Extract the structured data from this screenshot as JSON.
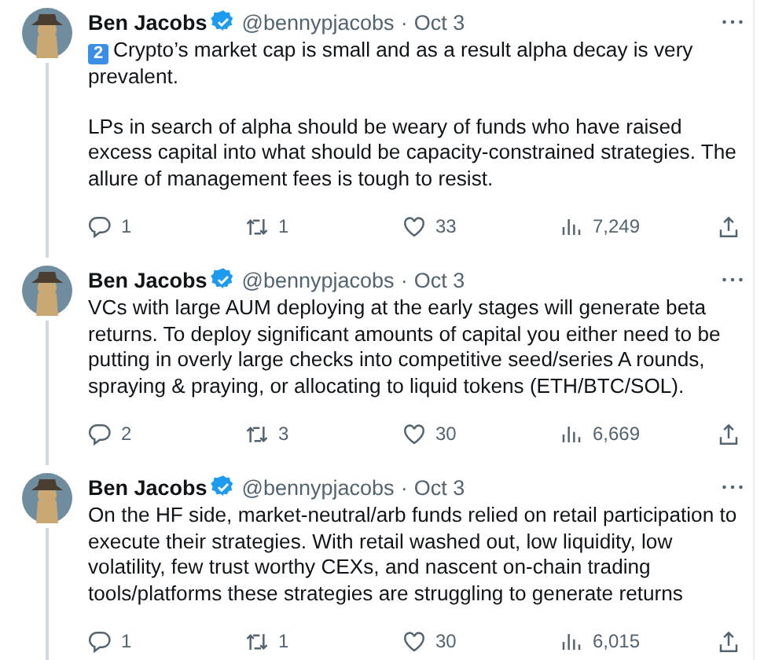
{
  "tweets": [
    {
      "name": "Ben Jacobs",
      "handle": "@bennypjacobs",
      "separator": "·",
      "date": "Oct 3",
      "badge": "2",
      "paragraphs": [
        "Crypto’s market cap is small and as a result alpha decay is very prevalent.",
        "LPs in search of alpha should be weary of funds who have raised excess capital into what should be capacity-constrained strategies. The allure of management fees is tough to resist."
      ],
      "replies": "1",
      "reposts": "1",
      "likes": "33",
      "views": "7,249"
    },
    {
      "name": "Ben Jacobs",
      "handle": "@bennypjacobs",
      "separator": "·",
      "date": "Oct 3",
      "paragraphs": [
        "VCs with large AUM deploying at the early stages will generate beta returns. To deploy significant amounts of capital you either need to be putting in overly large checks into competitive seed/series A rounds, spraying & praying, or allocating to liquid tokens (ETH/BTC/SOL)."
      ],
      "replies": "2",
      "reposts": "3",
      "likes": "30",
      "views": "6,669"
    },
    {
      "name": "Ben Jacobs",
      "handle": "@bennypjacobs",
      "separator": "·",
      "date": "Oct 3",
      "paragraphs": [
        "On the HF side, market-neutral/arb funds relied on retail participation to execute their strategies. With retail washed out, low liquidity, low volatility, few trust worthy CEXs, and nascent on-chain trading tools/platforms these strategies are struggling to generate returns"
      ],
      "replies": "1",
      "reposts": "1",
      "likes": "30",
      "views": "6,015"
    }
  ]
}
